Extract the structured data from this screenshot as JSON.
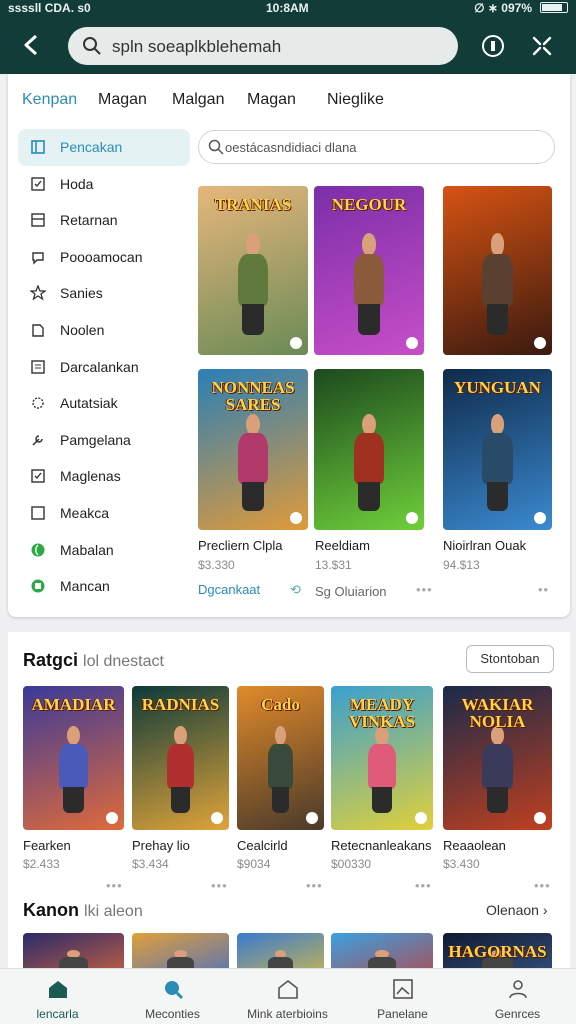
{
  "status_bar": {
    "left": "ssssll CDA. s0",
    "time": "10:8AM",
    "right": "∅ ∗ 097%",
    "battery_level": 0.85
  },
  "search": {
    "value": "spln soeaplkblehemah"
  },
  "tabs": [
    {
      "label": "Kenpan",
      "active": true
    },
    {
      "label": "Magan",
      "active": false
    },
    {
      "label": "Malgan",
      "active": false
    },
    {
      "label": "Magan",
      "active": false
    },
    {
      "label": "Nieglike",
      "active": false
    }
  ],
  "sidebar": {
    "items": [
      {
        "label": "Pencakan",
        "icon": "square-icon",
        "active": true
      },
      {
        "label": "Hoda",
        "icon": "check-square-icon"
      },
      {
        "label": "Retarnan",
        "icon": "minus-square-icon"
      },
      {
        "label": "Poooamocan",
        "icon": "chat-icon"
      },
      {
        "label": "Sanies",
        "icon": "star-icon"
      },
      {
        "label": "Noolen",
        "icon": "shield-icon"
      },
      {
        "label": "Darcalankan",
        "icon": "list-icon"
      },
      {
        "label": "Autatsiak",
        "icon": "gear-icon"
      },
      {
        "label": "Pamgelana",
        "icon": "tool-icon"
      },
      {
        "label": "Maglenas",
        "icon": "check-box-icon"
      },
      {
        "label": "Meakca",
        "icon": "empty-square-icon"
      },
      {
        "label": "Mabalan",
        "icon": "leaf-icon",
        "color": "#2ea843"
      },
      {
        "label": "Mancan",
        "icon": "puzzle-icon",
        "color": "#2ea843"
      }
    ]
  },
  "content_search": {
    "placeholder": "oestácasndidiaci dlana"
  },
  "grid": {
    "items": [
      {
        "title": "TRANIAS",
        "bg": [
          "#e6b77c",
          "#6a8a55"
        ],
        "armor": "#5f7a3c"
      },
      {
        "title": "NEGOUR",
        "bg": [
          "#7b2fa8",
          "#c84ec9"
        ],
        "armor": "#8a5a3a"
      },
      {
        "title": "",
        "bg": [
          "#d65312",
          "#3a1a10"
        ],
        "armor": "#5a4030"
      },
      {
        "title": "NONNEAS SARES",
        "bg": [
          "#2a7fb8",
          "#e09a3a"
        ],
        "armor": "#b23a6a"
      },
      {
        "title": "",
        "bg": [
          "#1c4a1e",
          "#6fcf3a"
        ],
        "armor": "#a03020"
      },
      {
        "title": "YUNGUAN",
        "bg": [
          "#0f2a4a",
          "#3a8ad0"
        ],
        "armor": "#2a4a6a"
      }
    ],
    "captions": [
      {
        "title": "Precliern Clpla",
        "sub": "$3.330"
      },
      {
        "title": "Reeldiam",
        "sub": "13.$31"
      },
      {
        "title": "Nioirlran Ouak",
        "sub": "94.$13"
      }
    ],
    "footer_links": [
      "Dgcankaat",
      "Sg Oluiarion"
    ]
  },
  "ratgoi": {
    "title": "Ratgci",
    "subtitle": "lol dnestact",
    "button": "Stontoban",
    "items": [
      {
        "title": "AMADIAR",
        "name": "Fearken",
        "price": "$2.433",
        "bg": [
          "#3a3a9a",
          "#e06a3a"
        ],
        "armor": "#4a5ab8"
      },
      {
        "title": "RADNIAS",
        "name": "Prehay lio",
        "price": "$3.434",
        "bg": [
          "#0d3a3a",
          "#e0a43a"
        ],
        "armor": "#b03030"
      },
      {
        "title": "Cado",
        "name": "Cealcirld",
        "price": "$9034",
        "bg": [
          "#e08a2a",
          "#4a3a2a"
        ],
        "armor": "#3a4a3a"
      },
      {
        "title": "MEADY VINKAS",
        "name": "Retecnanleakans",
        "price": "$00330",
        "bg": [
          "#3aa0d0",
          "#e0d03a"
        ],
        "armor": "#e05a7a"
      },
      {
        "title": "WAKIAR NOLIA",
        "name": "Reaaolean",
        "price": "$3.430",
        "bg": [
          "#1a2a4a",
          "#c04020"
        ],
        "armor": "#3a3a5a"
      }
    ]
  },
  "kanon": {
    "title": "Kanon",
    "subtitle": "lki aleon",
    "more": "Olenaon",
    "items": [
      {
        "title": "",
        "bg": [
          "#2a2a6a",
          "#e06a3a"
        ]
      },
      {
        "title": "",
        "bg": [
          "#e0a03a",
          "#3a6ad0"
        ]
      },
      {
        "title": "",
        "bg": [
          "#3a7ad0",
          "#e0c03a"
        ]
      },
      {
        "title": "",
        "bg": [
          "#3aa0e0",
          "#c04040"
        ]
      },
      {
        "title": "HAGORNAS",
        "bg": [
          "#101a30",
          "#3a5a8a"
        ]
      }
    ]
  },
  "bottom_nav": [
    {
      "label": "lencarla",
      "icon": "home-icon",
      "active": true
    },
    {
      "label": "Meconties",
      "icon": "chat-search-icon",
      "active": false
    },
    {
      "label": "Mink aterbioins",
      "icon": "house-outline-icon",
      "active": false
    },
    {
      "label": "Panelane",
      "icon": "picture-icon",
      "active": false
    },
    {
      "label": "Genrces",
      "icon": "person-icon",
      "active": false
    }
  ],
  "colors": {
    "topbar": "#123c37",
    "accent": "#2a8db5",
    "active_bg": "#e4f2f4"
  }
}
